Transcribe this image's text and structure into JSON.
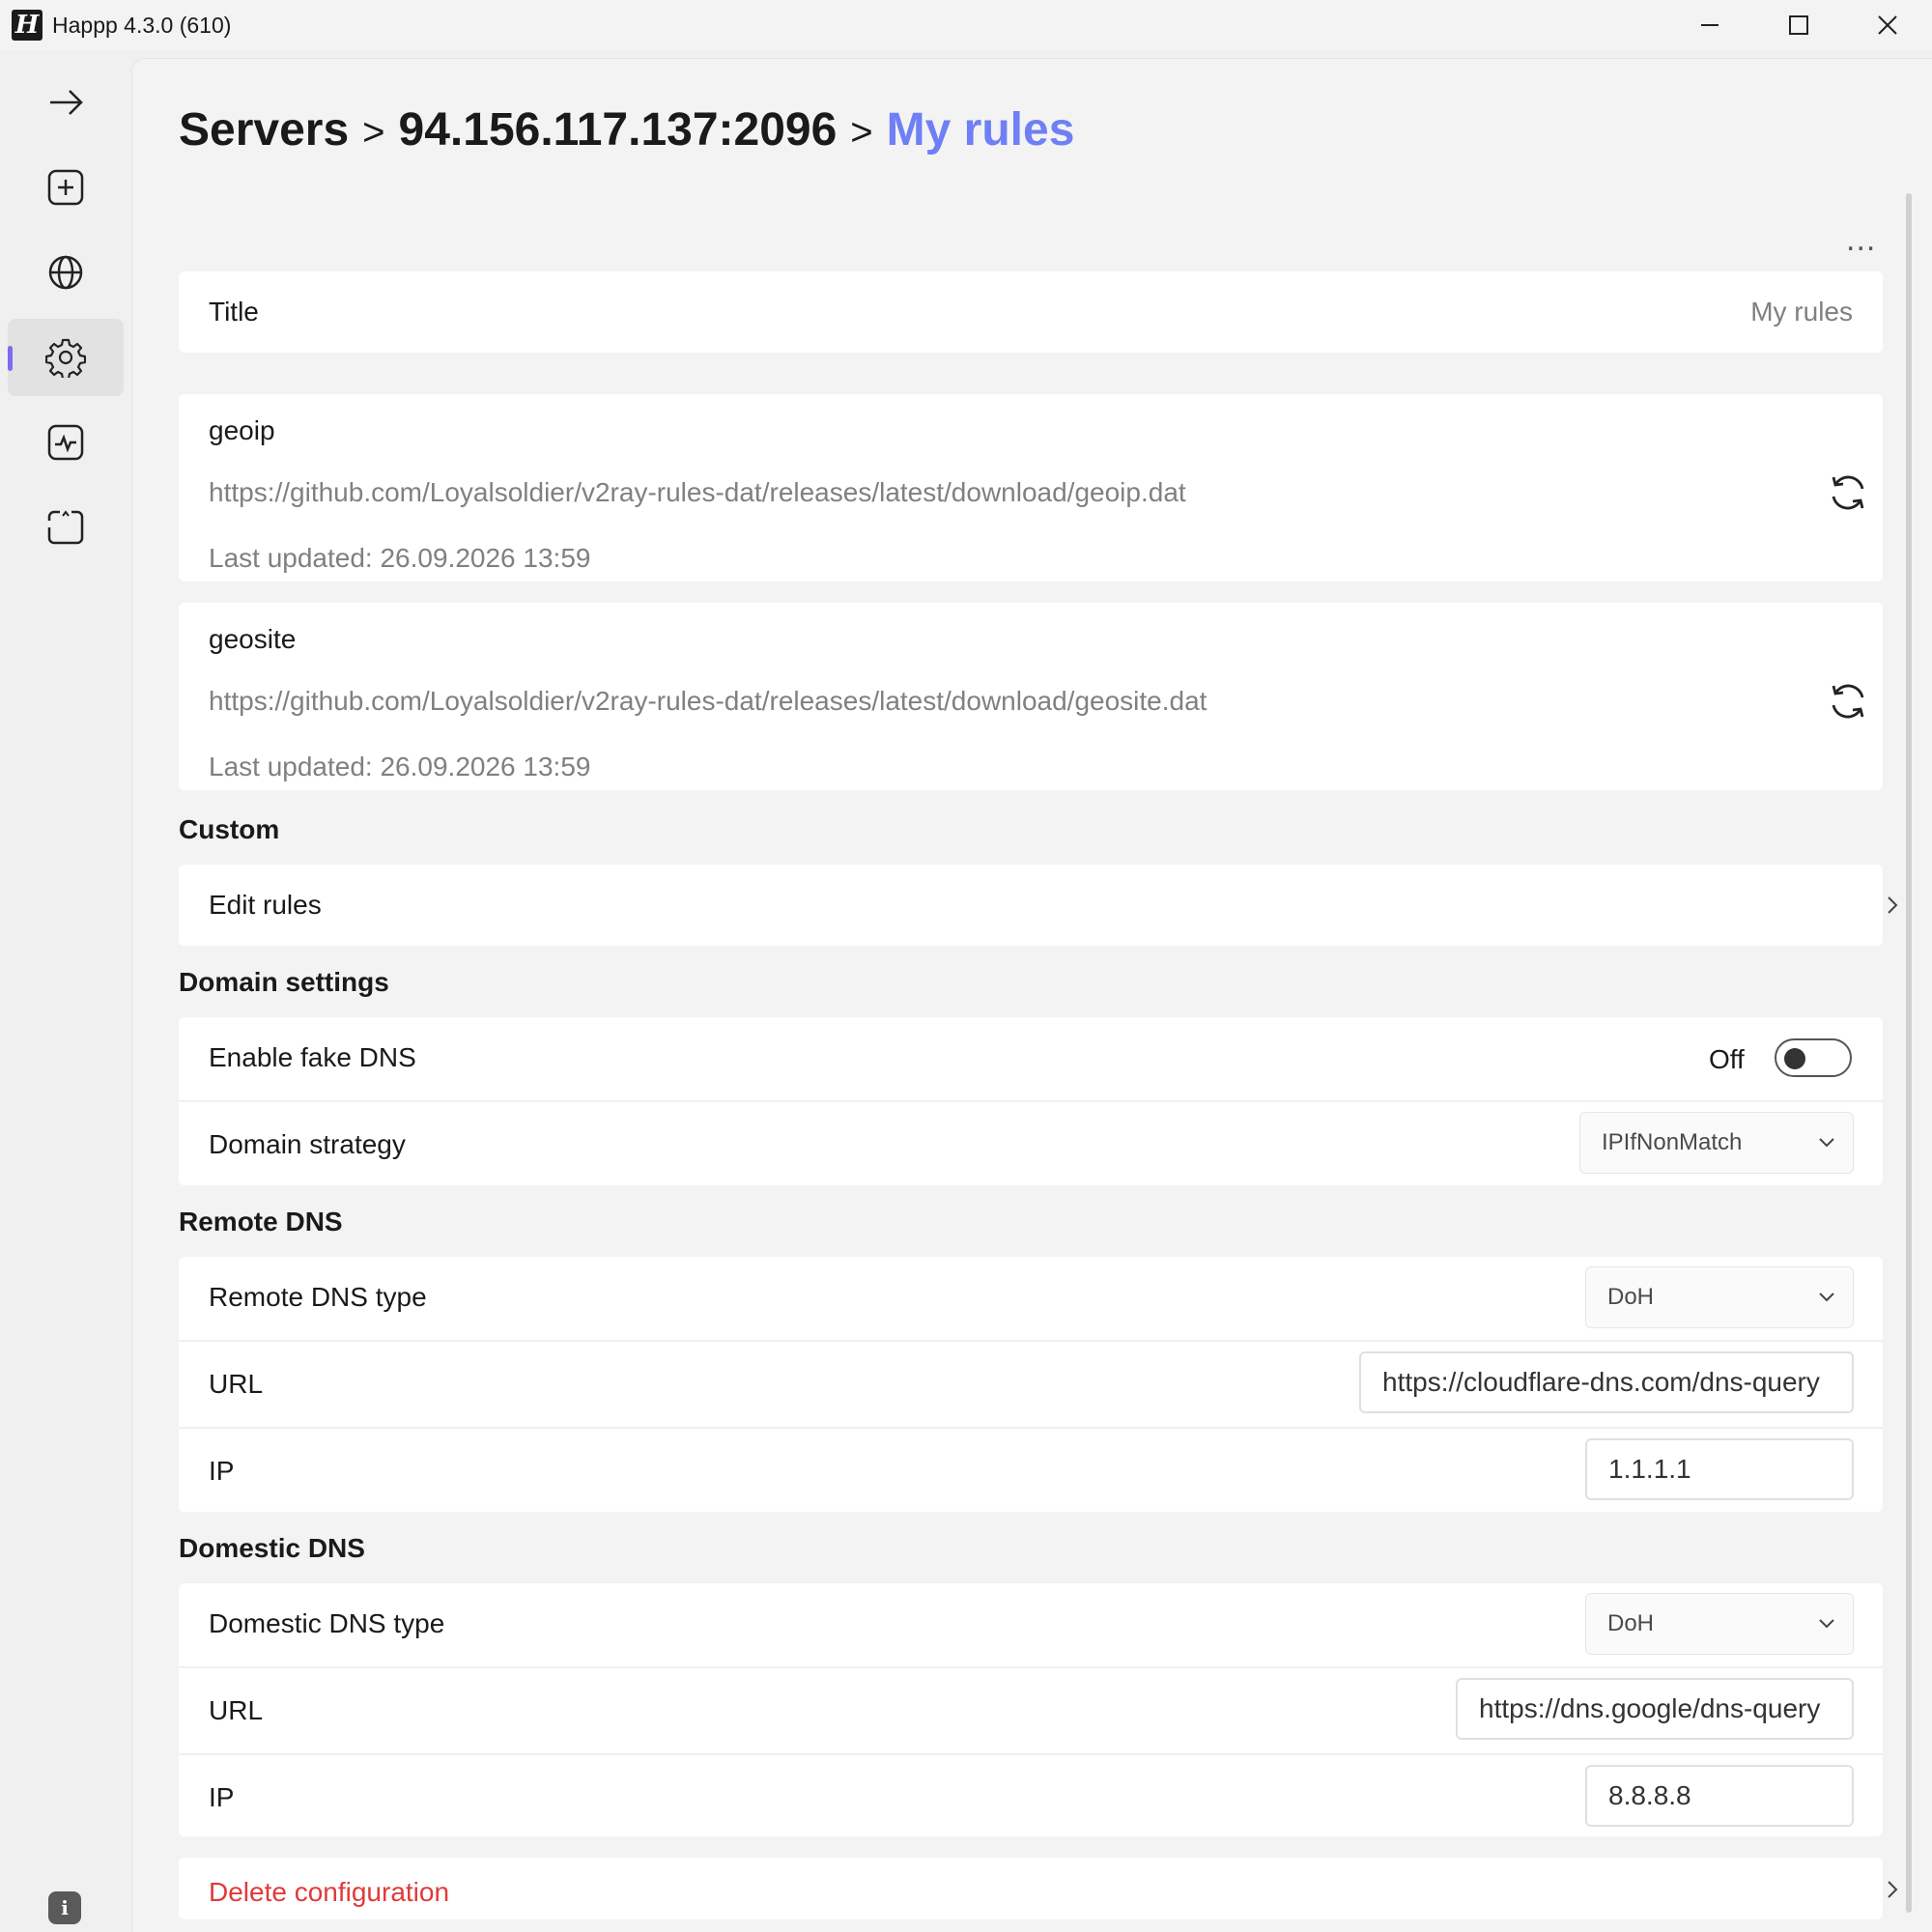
{
  "window": {
    "title": "Happp 4.3.0 (610)",
    "logo_letter": "H"
  },
  "breadcrumb": {
    "part1": "Servers",
    "part2": "94.156.117.137:2096",
    "current": "My rules",
    "separator": ">"
  },
  "more_button": "...",
  "title_row": {
    "label": "Title",
    "value": "My rules"
  },
  "geoip": {
    "name": "geoip",
    "url": "https://github.com/Loyalsoldier/v2ray-rules-dat/releases/latest/download/geoip.dat",
    "updated": "Last updated: 26.09.2026 13:59"
  },
  "geosite": {
    "name": "geosite",
    "url": "https://github.com/Loyalsoldier/v2ray-rules-dat/releases/latest/download/geosite.dat",
    "updated": "Last updated: 26.09.2026 13:59"
  },
  "custom": {
    "section": "Custom",
    "edit_rules": "Edit rules"
  },
  "domain_settings": {
    "section": "Domain settings",
    "fake_dns_label": "Enable fake DNS",
    "fake_dns_state": "Off",
    "strategy_label": "Domain strategy",
    "strategy_value": "IPIfNonMatch"
  },
  "remote_dns": {
    "section": "Remote DNS",
    "type_label": "Remote DNS type",
    "type_value": "DoH",
    "url_label": "URL",
    "url_value": "https://cloudflare-dns.com/dns-query",
    "ip_label": "IP",
    "ip_value": "1.1.1.1"
  },
  "domestic_dns": {
    "section": "Domestic DNS",
    "type_label": "Domestic DNS type",
    "type_value": "DoH",
    "url_label": "URL",
    "url_value": "https://dns.google/dns-query",
    "ip_label": "IP",
    "ip_value": "8.8.8.8"
  },
  "delete": {
    "label": "Delete configuration"
  },
  "info_icon": "i",
  "colors": {
    "accent": "#6f7ff5",
    "danger": "#e03a3a",
    "active_indicator": "#7b6cf0"
  },
  "icons": [
    "arrow-right-icon",
    "add-square-icon",
    "globe-icon",
    "gear-icon",
    "activity-icon",
    "scan-icon",
    "refresh-icon",
    "chevron-right-icon",
    "chevron-down-icon",
    "info-icon"
  ]
}
